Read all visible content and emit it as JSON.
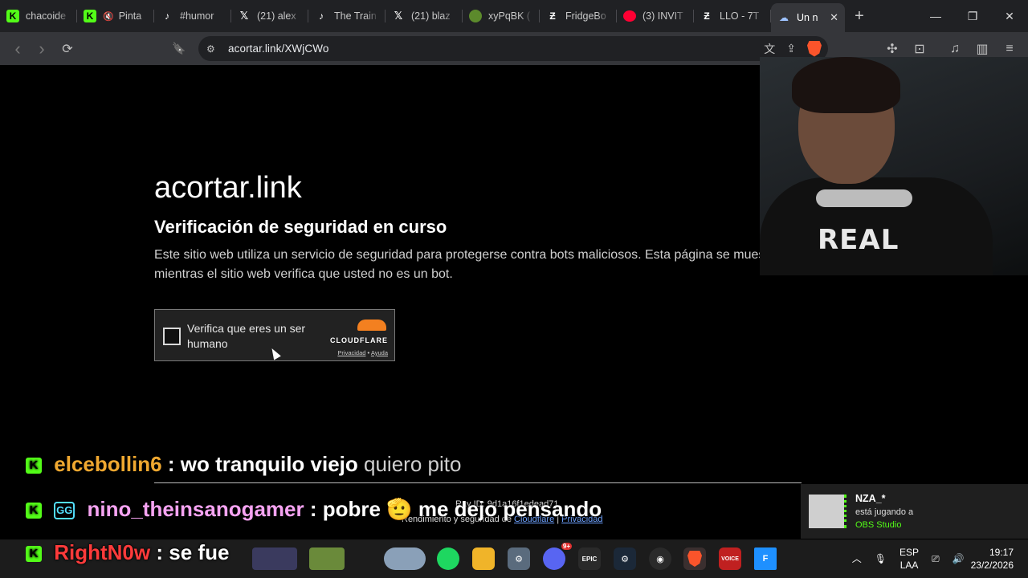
{
  "browser": {
    "tabs": [
      {
        "title": "chacoide",
        "icon": "kick-icon",
        "fav": "kick",
        "glyph": "K"
      },
      {
        "title": "Pinta",
        "icon": "kick-icon",
        "fav": "kick",
        "glyph": "K",
        "muted": true
      },
      {
        "title": "#humor",
        "icon": "tiktok-icon",
        "fav": "tiktok",
        "glyph": "♪"
      },
      {
        "title": "(21) alex",
        "icon": "x-icon",
        "fav": "x",
        "glyph": "𝕏"
      },
      {
        "title": "The Train",
        "icon": "tiktok-icon",
        "fav": "tiktok",
        "glyph": "♪"
      },
      {
        "title": "(21) blaz",
        "icon": "x-icon",
        "fav": "x",
        "glyph": "𝕏"
      },
      {
        "title": "xyPqBK (",
        "icon": "frog-icon",
        "fav": "frog",
        "glyph": ""
      },
      {
        "title": "FridgeBo",
        "icon": "fridgebot-icon",
        "fav": "fridge",
        "glyph": "Ƶ"
      },
      {
        "title": "(3) INVIT",
        "icon": "youtube-icon",
        "fav": "yt",
        "glyph": ""
      },
      {
        "title": "LLO - 7T",
        "icon": "fridgebot-icon",
        "fav": "fridge",
        "glyph": "Ƶ"
      }
    ],
    "active_tab": {
      "title": "Un n",
      "icon": "cloud-icon",
      "close": "✕"
    },
    "new_tab": "+",
    "window_controls": {
      "minimize": "—",
      "maximize": "❐",
      "close": "✕"
    },
    "nav": {
      "back": "‹",
      "forward": "›",
      "reload": "⟳",
      "bookmark": "🔖"
    },
    "url": "acortar.link/XWjCWo"
  },
  "page": {
    "site_title": "acortar.link",
    "heading": "Verificación de seguridad en curso",
    "description": "Este sitio web utiliza un servicio de seguridad para protegerse contra bots maliciosos. Esta página se muestra mientras el sitio web verifica que usted no es un bot.",
    "turnstile": {
      "label": "Verifica que eres un ser humano",
      "brand": "CLOUDFLARE",
      "privacy": "Privacidad",
      "separator": "•",
      "help": "Ayuda"
    },
    "ray_id": "Ray ID: 9d1a16f1edead71",
    "footer_prefix": "Rendimiento y seguridad de",
    "footer_link1": "Cloudflare",
    "footer_sep": "|",
    "footer_link2": "Privacidad"
  },
  "chat": [
    {
      "user": "elcebollin6",
      "sep": ":",
      "message": "wo tranquilo viejo",
      "extra": "quiero pito"
    },
    {
      "user": "nino_theinsanogamer",
      "sep": ":",
      "message": "pobre",
      "extra": "me dejo pensando",
      "badge": "GG"
    },
    {
      "user": "RightN0w",
      "sep": ":",
      "message": "se fue"
    }
  ],
  "notification": {
    "name": "NZA_*",
    "status": "está jugando a",
    "game": "OBS Studio"
  },
  "webcam": {
    "shirt_text": "REAL"
  },
  "taskbar": {
    "apps": [
      "spotify",
      "files",
      "settings",
      "discord",
      "epic",
      "steam",
      "obs",
      "brave",
      "voicemeeter",
      "fortnite"
    ],
    "epic_label": "EPIC",
    "voicemeeter_label": "VOICE",
    "fortnite_label": "F",
    "discord_badge": "9+",
    "lang": "ESP",
    "layout": "LAA",
    "time": "19:17",
    "date": "23/2/2026"
  },
  "colors": {
    "kick_green": "#53fc18",
    "cloudflare_orange": "#f38020",
    "link_blue": "#6ea2ff"
  }
}
